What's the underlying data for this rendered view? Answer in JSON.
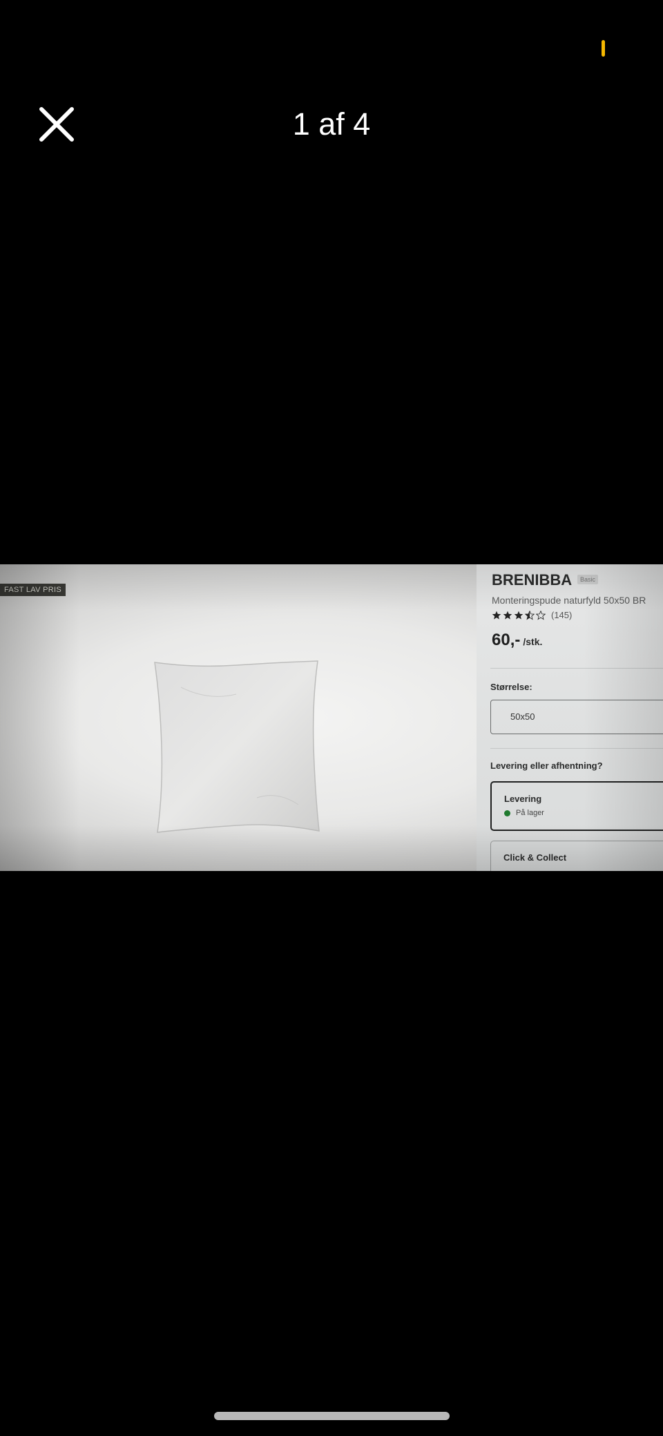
{
  "viewer": {
    "counter": "1 af 4"
  },
  "colors": {
    "status_indicator": "#f5b800",
    "background": "#000000",
    "in_stock_dot": "#1f7a2e"
  },
  "product": {
    "badge": "FAST LAV PRIS",
    "brand": "BRENIBBA",
    "brand_tag": "Basic",
    "subtitle": "Monteringspude naturfyld 50x50 BR",
    "rating_stars": 3.5,
    "rating_count": "(145)",
    "price": "60,-",
    "price_unit": "/stk.",
    "size_label": "Størrelse:",
    "size_value": "50x50",
    "delivery_question": "Levering eller afhentning?",
    "delivery_option": {
      "title": "Levering",
      "status": "På lager"
    },
    "click_collect_option": {
      "title": "Click & Collect"
    }
  }
}
